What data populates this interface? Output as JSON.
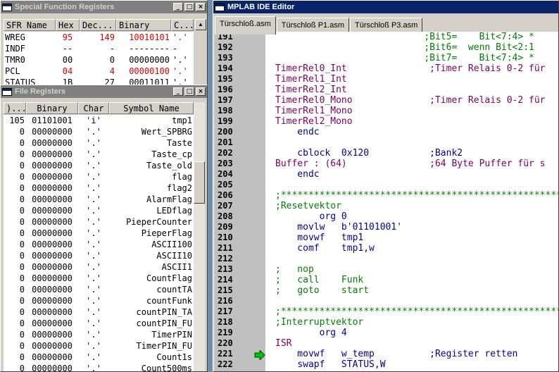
{
  "sfr": {
    "title": "Special Function Registers",
    "headers": [
      "SFR Name",
      "Hex",
      "Dec...",
      "Binary",
      "C..."
    ],
    "rows": [
      {
        "name": "WREG",
        "hex": "95",
        "dec": "149",
        "bin": "10010101",
        "chr": "'.'",
        "changed": true
      },
      {
        "name": "INDF",
        "hex": "--",
        "dec": "-",
        "bin": "--------",
        "chr": "-",
        "changed": false
      },
      {
        "name": "TMR0",
        "hex": "00",
        "dec": "0",
        "bin": "00000000",
        "chr": "'.'",
        "changed": false
      },
      {
        "name": "PCL",
        "hex": "04",
        "dec": "4",
        "bin": "00000100",
        "chr": "'.'",
        "changed": true
      },
      {
        "name": "STATUS",
        "hex": "1B",
        "dec": "27",
        "bin": "00011011",
        "chr": "'.'",
        "changed": false
      }
    ]
  },
  "fileregs": {
    "title": "File Registers",
    "headers": [
      ")...",
      "Binary",
      "Char",
      "Symbol Name"
    ],
    "rows": [
      {
        "dec": "105",
        "bin": "01101001",
        "chr": "'i'",
        "sym": "tmp1"
      },
      {
        "dec": "0",
        "bin": "00000000",
        "chr": "'.'",
        "sym": "Wert_SPBRG"
      },
      {
        "dec": "0",
        "bin": "00000000",
        "chr": "'.'",
        "sym": "Taste"
      },
      {
        "dec": "0",
        "bin": "00000000",
        "chr": "'.'",
        "sym": "Taste_cp"
      },
      {
        "dec": "0",
        "bin": "00000000",
        "chr": "'.'",
        "sym": "Taste_old"
      },
      {
        "dec": "0",
        "bin": "00000000",
        "chr": "'.'",
        "sym": "flag"
      },
      {
        "dec": "0",
        "bin": "00000000",
        "chr": "'.'",
        "sym": "flag2"
      },
      {
        "dec": "0",
        "bin": "00000000",
        "chr": "'.'",
        "sym": "AlarmFlag"
      },
      {
        "dec": "0",
        "bin": "00000000",
        "chr": "'.'",
        "sym": "LEDflag"
      },
      {
        "dec": "0",
        "bin": "00000000",
        "chr": "'.'",
        "sym": "PieperCounter"
      },
      {
        "dec": "0",
        "bin": "00000000",
        "chr": "'.'",
        "sym": "PieperFlag"
      },
      {
        "dec": "0",
        "bin": "00000000",
        "chr": "'.'",
        "sym": "ASCII100"
      },
      {
        "dec": "0",
        "bin": "00000000",
        "chr": "'.'",
        "sym": "ASCII10"
      },
      {
        "dec": "0",
        "bin": "00000000",
        "chr": "'.'",
        "sym": "ASCII1"
      },
      {
        "dec": "0",
        "bin": "00000000",
        "chr": "'.'",
        "sym": "CountFlag"
      },
      {
        "dec": "0",
        "bin": "00000000",
        "chr": "'.'",
        "sym": "countTA"
      },
      {
        "dec": "0",
        "bin": "00000000",
        "chr": "'.'",
        "sym": "countFunk"
      },
      {
        "dec": "0",
        "bin": "00000000",
        "chr": "'.'",
        "sym": "countPIN_TA"
      },
      {
        "dec": "0",
        "bin": "00000000",
        "chr": "'.'",
        "sym": "countPIN_FU"
      },
      {
        "dec": "0",
        "bin": "00000000",
        "chr": "'.'",
        "sym": "TimerPIN"
      },
      {
        "dec": "0",
        "bin": "00000000",
        "chr": "'.'",
        "sym": "TimerPIN_FU"
      },
      {
        "dec": "0",
        "bin": "00000000",
        "chr": "'.'",
        "sym": "Count1s"
      },
      {
        "dec": "0",
        "bin": "00000000",
        "chr": "'.'",
        "sym": "Count500ms"
      }
    ]
  },
  "editor": {
    "title": "MPLAB IDE Editor",
    "tabs": [
      "Türschloß.asm",
      "Türschloß P1.asm",
      "Türschloß P3.asm"
    ],
    "lines": [
      {
        "n": "191",
        "t": "                           ;Bit5=    Bit<7:4> *"
      },
      {
        "n": "192",
        "t": "                           ;Bit6=  wenn Bit<2:1"
      },
      {
        "n": "193",
        "t": "                           ;Bit7=    Bit<7:4> *"
      },
      {
        "n": "194",
        "t": "TimerRel0_Int               ;Timer Relais 0-2 für"
      },
      {
        "n": "195",
        "t": "TimerRel1_Int"
      },
      {
        "n": "196",
        "t": "TimerRel2_Int"
      },
      {
        "n": "197",
        "t": "TimerRel0_Mono              ;Timer Relais 0-2 für"
      },
      {
        "n": "198",
        "t": "TimerRel1_Mono"
      },
      {
        "n": "199",
        "t": "TimerRel2_Mono"
      },
      {
        "n": "200",
        "t": "    endc"
      },
      {
        "n": "201",
        "t": ""
      },
      {
        "n": "202",
        "t": "    cblock  0x120           ;Bank2"
      },
      {
        "n": "203",
        "t": "Buffer : (64)               ;64 Byte Puffer für s"
      },
      {
        "n": "204",
        "t": "    endc"
      },
      {
        "n": "205",
        "t": ""
      },
      {
        "n": "206",
        "t": ";*****************************************************"
      },
      {
        "n": "207",
        "t": ";Resetvektor"
      },
      {
        "n": "208",
        "t": "        org 0"
      },
      {
        "n": "209",
        "t": "    movlw   b'01101001'"
      },
      {
        "n": "210",
        "t": "    movwf   tmp1"
      },
      {
        "n": "211",
        "t": "    comf    tmp1,w"
      },
      {
        "n": "212",
        "t": ""
      },
      {
        "n": "213",
        "t": ";   nop"
      },
      {
        "n": "214",
        "t": ";   call    Funk"
      },
      {
        "n": "215",
        "t": ";   goto    start"
      },
      {
        "n": "216",
        "t": ""
      },
      {
        "n": "217",
        "t": ";*****************************************************"
      },
      {
        "n": "218",
        "t": ";Interruptvektor"
      },
      {
        "n": "219",
        "t": "        org 4"
      },
      {
        "n": "220",
        "t": "ISR"
      },
      {
        "n": "221",
        "t": "    movwf   w_temp          ;Register retten"
      },
      {
        "n": "222",
        "t": "    swapf   STATUS,W"
      }
    ]
  }
}
